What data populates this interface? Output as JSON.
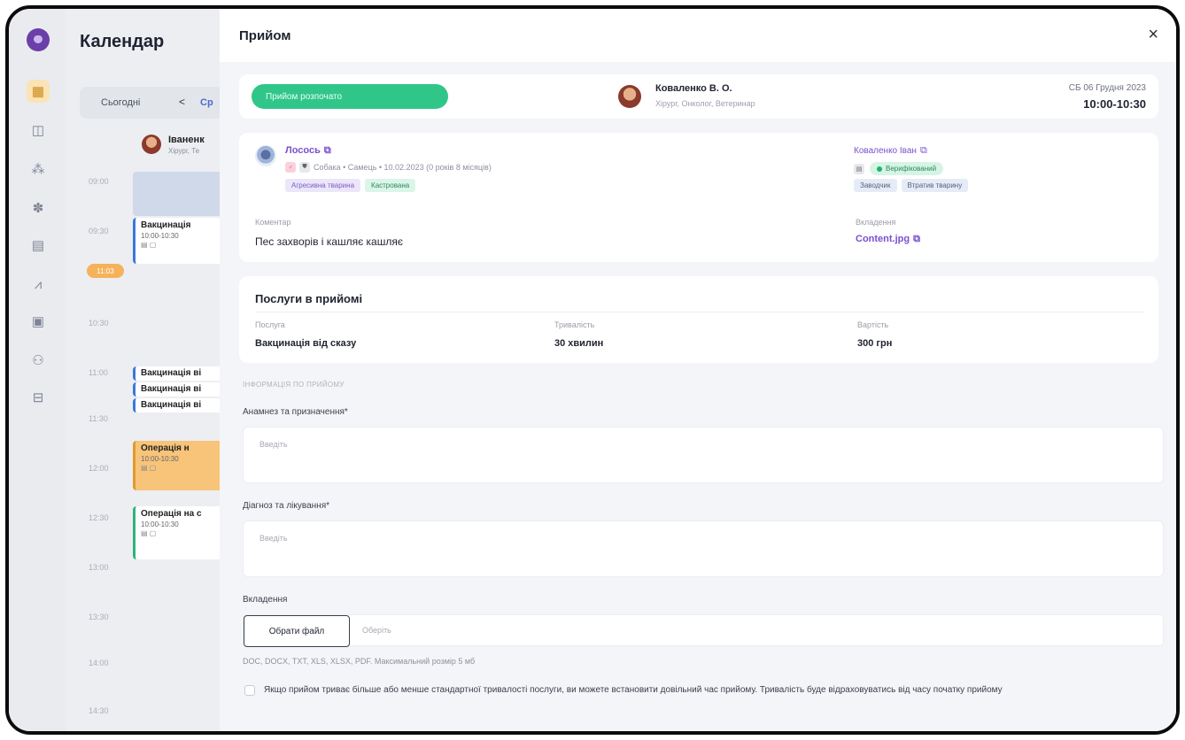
{
  "calendar": {
    "title": "Календар",
    "today_label": "Сьогодні",
    "prev_label": "<",
    "day_short": "Ср",
    "doctor_name": "Іваненк",
    "doctor_role": "Хірург, Те",
    "times": [
      "09:00",
      "09:30",
      "10:30",
      "11:00",
      "11:30",
      "12:00",
      "12:30",
      "13:00",
      "13:30",
      "14:00",
      "14:30"
    ],
    "now_badge": "11:03",
    "events": [
      {
        "title": "Вакцинація",
        "sub": "10:00-10:30"
      },
      {
        "title": "Вакцинація ві",
        "sub": ""
      },
      {
        "title": "Вакцинація ві",
        "sub": ""
      },
      {
        "title": "Вакцинація ві",
        "sub": ""
      },
      {
        "title": "Операція н",
        "sub": "10:00-10:30"
      },
      {
        "title": "Операція на с",
        "sub": "10:00-10:30"
      }
    ]
  },
  "modal": {
    "title": "Прийом",
    "close_label": "×",
    "status": "Прийом розпочато",
    "doctor": {
      "name": "Коваленко В. О.",
      "roles": "Хірург, Онколог, Ветеринар"
    },
    "date": "СБ 06 Грудня 2023",
    "time": "10:00-10:30"
  },
  "pet": {
    "name": "Лосось",
    "meta": "Собака • Самець • 10.02.2023 (0 років 8 місяців)",
    "tags": [
      "Агресивна тварина",
      "Кастрована"
    ],
    "owner": "Коваленко Іван",
    "verified": "Верифікований",
    "owner_tags": [
      "Заводчик",
      "Втратив тварину"
    ],
    "comment_label": "Коментар",
    "comment": "Пес захворів і кашляє кашляє",
    "attach_label": "Вкладення",
    "attach_file": "Content.jpg"
  },
  "services": {
    "title": "Послуги в прийомі",
    "col_service": "Послуга",
    "col_duration": "Тривалість",
    "col_price": "Вартість",
    "service": "Вакцинація від сказу",
    "duration": "30 хвилин",
    "price": "300 грн"
  },
  "form": {
    "section_caption": "ІНФОРМАЦІЯ ПО ПРИЙОМУ",
    "anamnesis_label": "Анамнез та призначення*",
    "anamnesis_placeholder": "Введіть",
    "diagnosis_label": "Діагноз та лікування*",
    "diagnosis_placeholder": "Введіть",
    "attachments_label": "Вкладення",
    "file_button": "Обрати файл",
    "file_placeholder": "Оберіть",
    "file_hint": "DOC, DOCX, TXT, XLS, XLSX, PDF. Максимальний розмір 5 мб",
    "custom_time_label": "Якщо прийом триває більше або менше стандартної тривалості послуги, ви можете встановити довільний час прийому. Тривалість буде відраховуватись від часу початку прийому"
  }
}
